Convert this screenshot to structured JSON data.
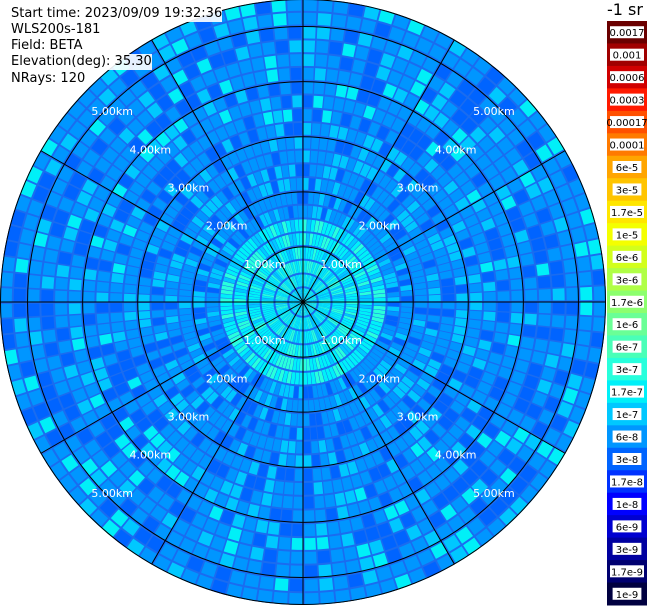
{
  "header": {
    "start_time": "Start time: 2023/09/09 19:32:36",
    "instrument": "WLS200s-181",
    "field": "Field: BETA",
    "elevation": "Elevation(deg): 35.30",
    "nrays": "NRays: 120"
  },
  "colorbar": {
    "unit_label": "-1 sr",
    "labels": [
      "0.0017",
      "0.001",
      "0.0006",
      "0.0003",
      "0.00017",
      "0.0001",
      "6e-5",
      "3e-5",
      "1.7e-5",
      "1e-5",
      "6e-6",
      "3e-6",
      "1.7e-6",
      "1e-6",
      "6e-7",
      "3e-7",
      "1.7e-7",
      "1e-7",
      "6e-8",
      "3e-8",
      "1.7e-8",
      "1e-8",
      "6e-9",
      "3e-9",
      "1.7e-9",
      "1e-9"
    ],
    "colors": [
      "#6a0000",
      "#a00000",
      "#d00000",
      "#ff1a00",
      "#ff5000",
      "#ff7a00",
      "#ffa500",
      "#ffc400",
      "#ffe600",
      "#f4ff00",
      "#d2ff1c",
      "#b0ff46",
      "#8cff6e",
      "#6aff96",
      "#4affb8",
      "#28ffdc",
      "#00f0f8",
      "#00c8ff",
      "#0096ff",
      "#0064ff",
      "#0032ff",
      "#0000ff",
      "#0000d0",
      "#0000a0",
      "#000070",
      "#000040"
    ]
  },
  "chart_data": {
    "type": "heatmap",
    "projection": "polar-ppi",
    "field": "BETA",
    "elevation_deg": 35.3,
    "n_rays": 120,
    "range_rings_km": [
      1,
      2,
      3,
      4,
      5
    ],
    "ring_labels": [
      "1.00km",
      "2.00km",
      "3.00km",
      "4.00km",
      "5.00km"
    ],
    "max_range_km": 5.5,
    "spoke_step_deg": 30,
    "color_scale": "log",
    "value_range": [
      1e-09,
      0.0017
    ],
    "typical_values": {
      "near_center": 1.7e-07,
      "mid_range": 3e-08,
      "far_range": 1e-08
    },
    "grid": true
  }
}
